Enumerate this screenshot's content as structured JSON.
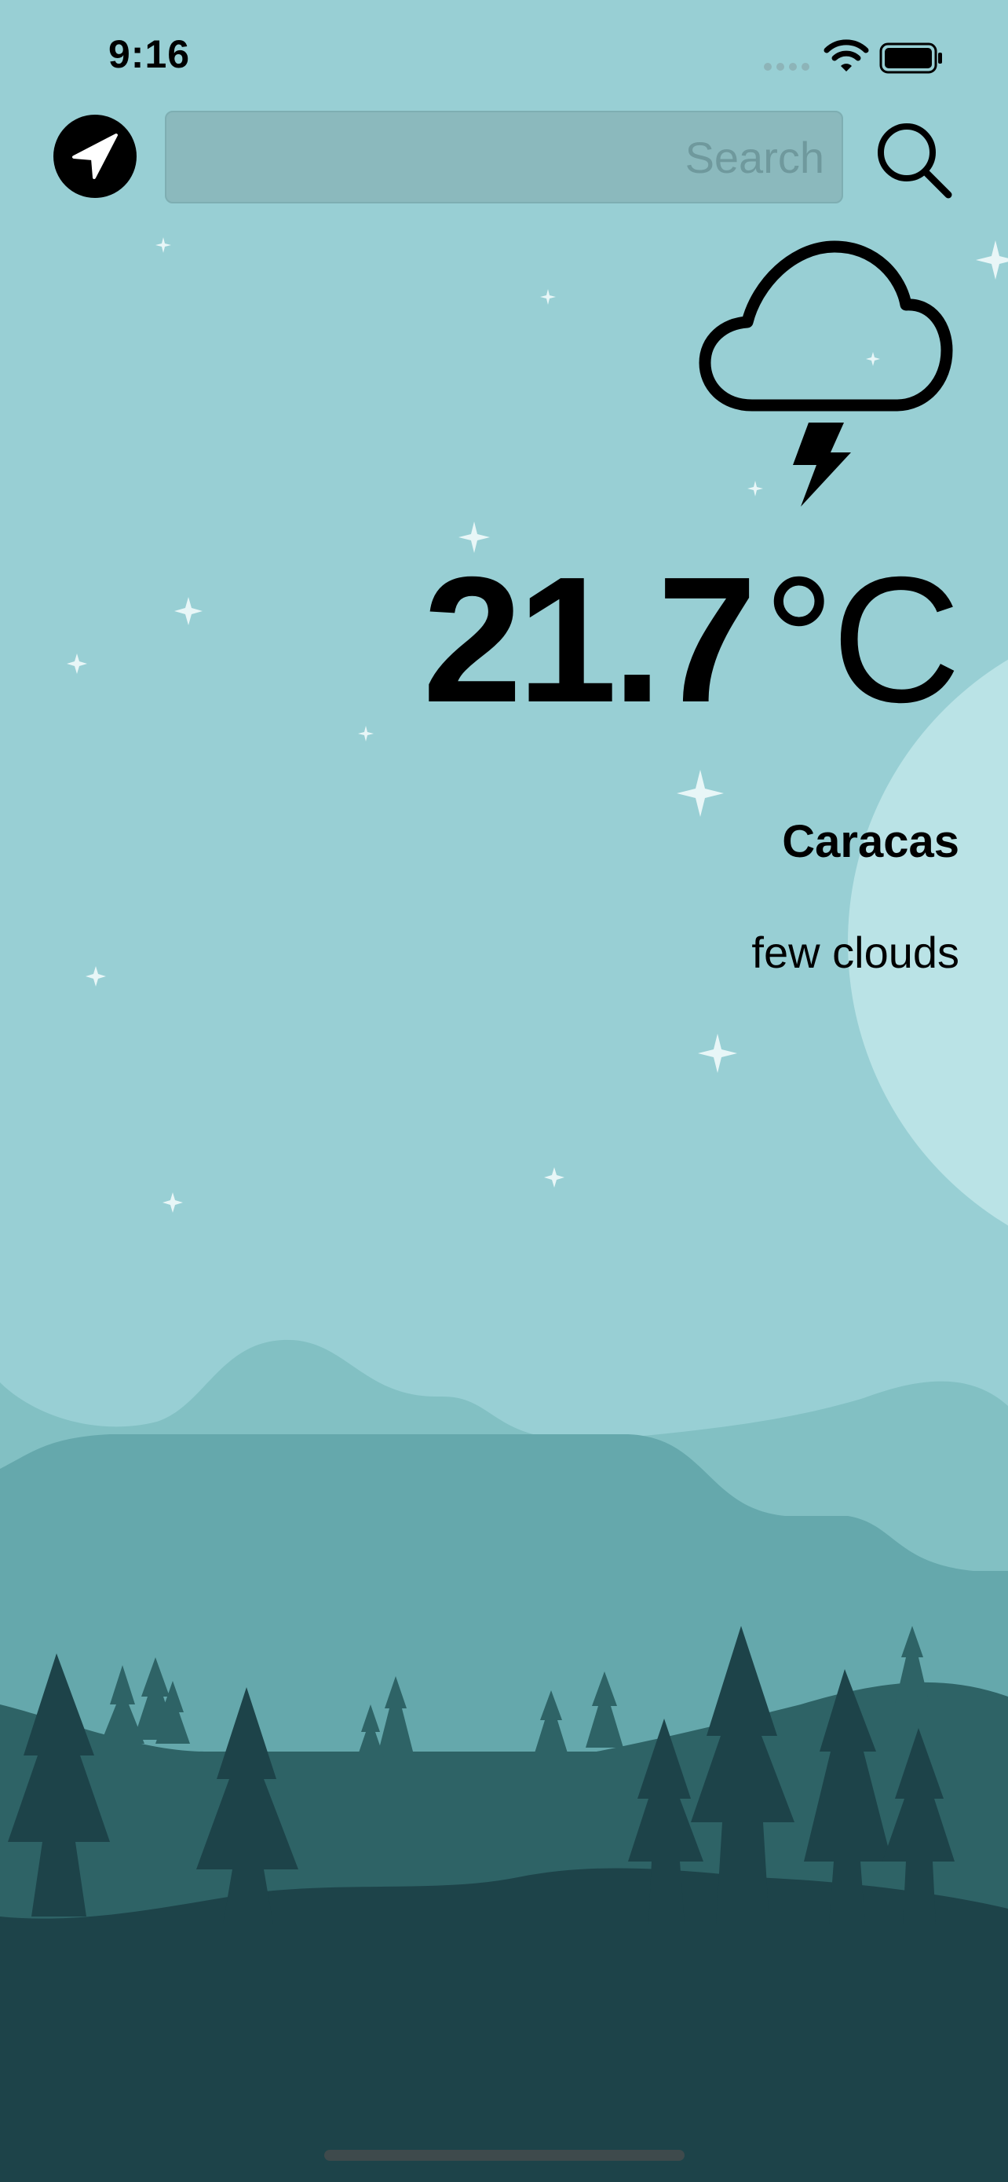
{
  "status_bar": {
    "time": "9:16",
    "icons": [
      "signal-dots-icon",
      "wifi-icon",
      "battery-icon"
    ]
  },
  "top_bar": {
    "location_icon": "location-arrow-icon",
    "search": {
      "placeholder": "Search",
      "value": ""
    },
    "search_icon": "magnifier-icon"
  },
  "weather": {
    "condition_icon": "cloud-lightning-icon",
    "temperature_value": "21.7",
    "temperature_unit": "°C",
    "city": "Caracas",
    "description": "few clouds"
  },
  "theme": {
    "sky": "#98cfd4",
    "moon": "#bae3e6",
    "hills_far": "#82c0c3",
    "hills_mid": "#65a8ac",
    "forest_back": "#2e6366",
    "forest_front": "#1d4349",
    "ink": "#000000"
  }
}
